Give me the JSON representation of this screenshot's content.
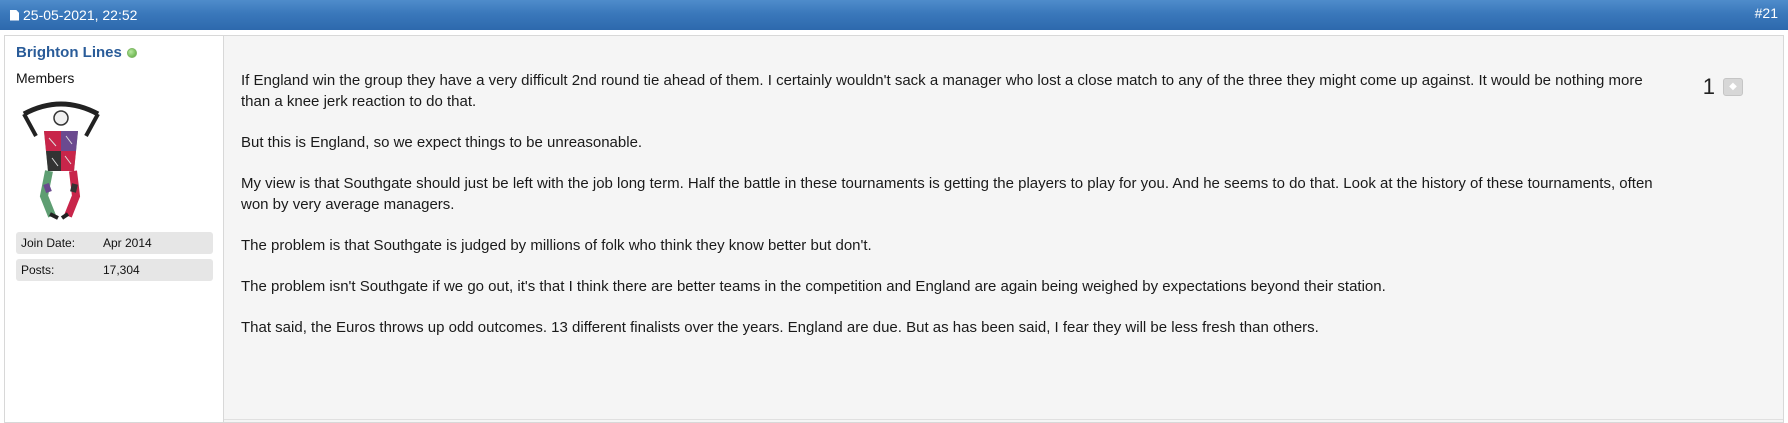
{
  "header": {
    "date": "25-05-2021, 22:52",
    "post_number": "#21"
  },
  "user": {
    "name": "Brighton Lines",
    "title": "Members",
    "stats": [
      {
        "label": "Join Date:",
        "value": "Apr 2014"
      },
      {
        "label": "Posts:",
        "value": "17,304"
      }
    ]
  },
  "post": {
    "paragraphs": [
      "If England win the group they have a very difficult 2nd round tie ahead of them. I certainly wouldn't sack a manager who lost a close match to any of the three they might come up against. It would be nothing more than a knee jerk reaction to do that.",
      "But this is England, so we expect things to be unreasonable.",
      "My view is that Southgate should just be left with the job long term. Half the battle in these tournaments is getting the players to play for you. And he seems to do that. Look at the history of these tournaments, often won by very average managers.",
      "The problem is that Southgate is judged by millions of folk who think they know better but don't.",
      "The problem isn't Southgate if we go out, it's that I think there are better teams in the competition and England are again being weighed by expectations beyond their station.",
      "That said, the Euros throws up odd outcomes. 13 different finalists over the years. England are due. But as has been said, I fear they will be less fresh than others."
    ],
    "reputation": "1"
  },
  "icons": {
    "date": "document-icon",
    "online": "online-status-icon",
    "reputation": "reputation-icon"
  },
  "colors": {
    "header_bar": "#3a78bb",
    "username": "#2a5c99",
    "content_bg": "#f5f5f5"
  }
}
